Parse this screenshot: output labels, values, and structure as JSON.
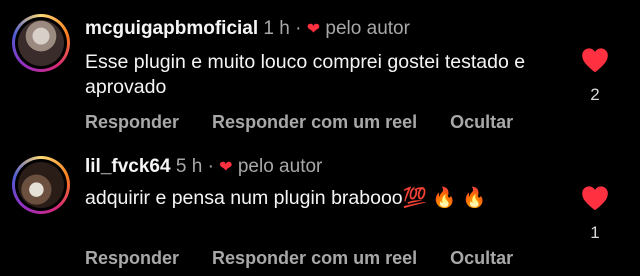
{
  "comments": [
    {
      "username": "mcguigapbmoficial",
      "time": "1 h",
      "author_like": "pelo autor",
      "text": "Esse plugin e muito louco comprei gostei testado e aprovado",
      "actions": [
        "Responder",
        "Responder com um reel",
        "Ocultar"
      ],
      "likes": "2"
    },
    {
      "username": "lil_fvck64",
      "time": "5 h",
      "author_like": "pelo autor",
      "text": "adquirir e pensa num plugin brabooo💯 🔥 🔥",
      "actions": [
        "Responder",
        "Responder com um reel",
        "Ocultar"
      ],
      "likes": "1"
    }
  ],
  "colors": {
    "heart": "#ff3040",
    "background": "#000000",
    "secondary_text": "#a8a8a8"
  },
  "icons": {
    "like": "heart-icon",
    "author_like": "heart-icon"
  }
}
